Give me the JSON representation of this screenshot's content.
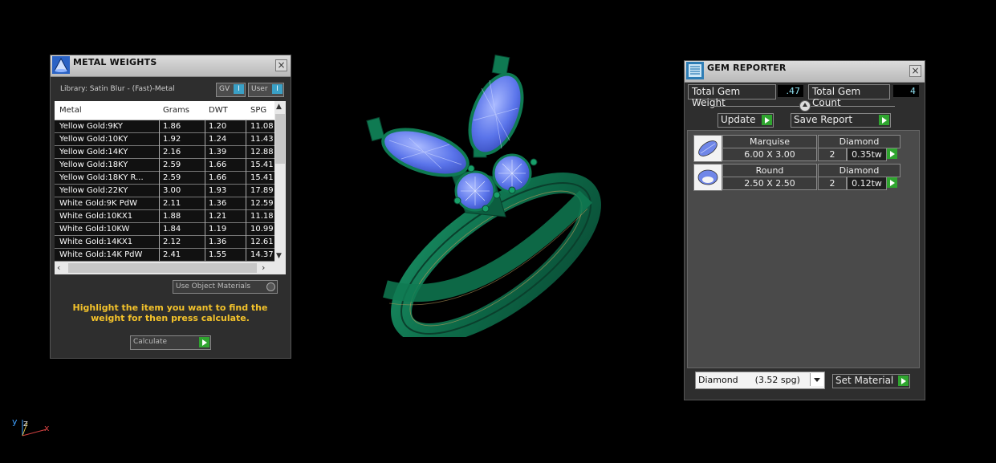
{
  "metal_weights": {
    "title": "METAL WEIGHTS",
    "library": "Library: Satin Blur - (Fast)-Metal",
    "toggles": [
      {
        "label": "GV",
        "state": "I"
      },
      {
        "label": "User",
        "state": "I"
      }
    ],
    "columns": [
      "Metal",
      "Grams",
      "DWT",
      "SPG"
    ],
    "rows": [
      {
        "metal": "Yellow Gold:9KY",
        "grams": "1.86",
        "dwt": "1.20",
        "spg": "11.08"
      },
      {
        "metal": "Yellow Gold:10KY",
        "grams": "1.92",
        "dwt": "1.24",
        "spg": "11.43"
      },
      {
        "metal": "Yellow Gold:14KY",
        "grams": "2.16",
        "dwt": "1.39",
        "spg": "12.88"
      },
      {
        "metal": "Yellow Gold:18KY",
        "grams": "2.59",
        "dwt": "1.66",
        "spg": "15.41"
      },
      {
        "metal": "Yellow Gold:18KY R...",
        "grams": "2.59",
        "dwt": "1.66",
        "spg": "15.41"
      },
      {
        "metal": "Yellow Gold:22KY",
        "grams": "3.00",
        "dwt": "1.93",
        "spg": "17.89"
      },
      {
        "metal": "White Gold:9K PdW",
        "grams": "2.11",
        "dwt": "1.36",
        "spg": "12.59"
      },
      {
        "metal": "White Gold:10KX1",
        "grams": "1.88",
        "dwt": "1.21",
        "spg": "11.18"
      },
      {
        "metal": "White Gold:10KW",
        "grams": "1.84",
        "dwt": "1.19",
        "spg": "10.99"
      },
      {
        "metal": "White Gold:14KX1",
        "grams": "2.12",
        "dwt": "1.36",
        "spg": "12.61"
      },
      {
        "metal": "White Gold:14K PdW",
        "grams": "2.41",
        "dwt": "1.55",
        "spg": "14.37"
      }
    ],
    "use_object_materials": "Use Object Materials",
    "hint": "Highlight the item you want to find the weight for then press calculate.",
    "calculate": "Calculate"
  },
  "gem_reporter": {
    "title": "GEM REPORTER",
    "total_weight_label": "Total Gem Weight",
    "total_weight_value": ".47",
    "total_count_label": "Total Gem Count",
    "total_count_value": "4",
    "update": "Update",
    "save_report": "Save Report",
    "gems": [
      {
        "shape": "Marquise",
        "material": "Diamond",
        "size": "6.00 X 3.00",
        "count": "2",
        "weight": "0.35tw"
      },
      {
        "shape": "Round",
        "material": "Diamond",
        "size": "2.50 X 2.50",
        "count": "2",
        "weight": "0.12tw"
      }
    ],
    "material_select": "Diamond      (3.52 spg)",
    "set_material": "Set Material"
  },
  "axis": {
    "y": "y",
    "z": "z",
    "x": "x"
  },
  "colors": {
    "ring": "#0f6b4a",
    "gem": "#5a7cf0",
    "hint": "#f3c22b",
    "go": "#2fa52f"
  }
}
